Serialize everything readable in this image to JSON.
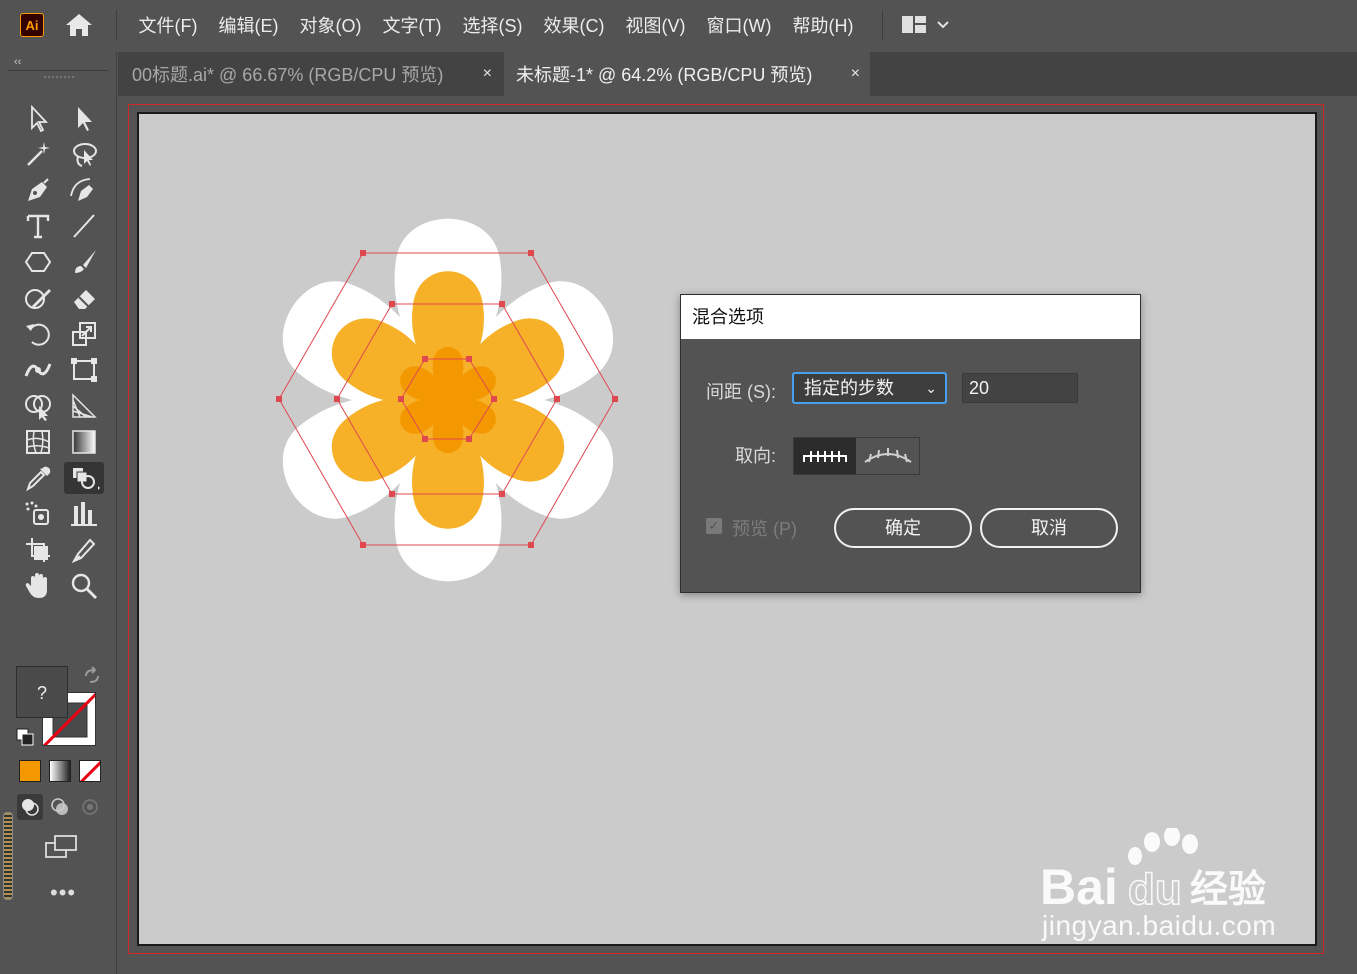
{
  "app": {
    "logo": "Ai"
  },
  "menubar": {
    "items": [
      "文件(F)",
      "编辑(E)",
      "对象(O)",
      "文字(T)",
      "选择(S)",
      "效果(C)",
      "视图(V)",
      "窗口(W)",
      "帮助(H)"
    ]
  },
  "tabs": [
    {
      "label": "00标题.ai* @ 66.67% (RGB/CPU 预览)",
      "close": "×",
      "active": false
    },
    {
      "label": "未标题-1* @ 64.2% (RGB/CPU 预览)",
      "close": "×",
      "active": true
    }
  ],
  "toolbar": {
    "collapse": "‹‹",
    "fill_unknown": "?",
    "more": "•••",
    "tools": [
      "selection-tool",
      "direct-selection-tool",
      "magic-wand-tool",
      "lasso-tool",
      "pen-tool",
      "curvature-tool",
      "type-tool",
      "line-tool",
      "polygon-tool",
      "paintbrush-tool",
      "shaper-tool",
      "eraser-tool",
      "rotate-tool",
      "scale-tool",
      "width-tool",
      "free-transform-tool",
      "shape-builder-tool",
      "perspective-grid-tool",
      "mesh-tool",
      "gradient-tool",
      "eyedropper-tool",
      "blend-tool",
      "symbol-sprayer-tool",
      "column-graph-tool",
      "artboard-tool",
      "slice-tool",
      "hand-tool",
      "zoom-tool"
    ],
    "colors": {
      "fill_mode": "#f39800"
    }
  },
  "dialog": {
    "title": "混合选项",
    "spacing_label": "间距 (S):",
    "spacing_value": "指定的步数",
    "steps_value": "20",
    "orientation_label": "取向:",
    "preview_label": "预览 (P)",
    "ok": "确定",
    "cancel": "取消"
  },
  "watermark": {
    "text": "jingyan.baidu.com",
    "brand": "Bai du 经验"
  },
  "colors": {
    "accent": "#45a1f0",
    "petal_outer": "#ffffff",
    "petal_mid": "#f6b128",
    "petal_inner": "#f39800",
    "selection": "#e04850"
  }
}
